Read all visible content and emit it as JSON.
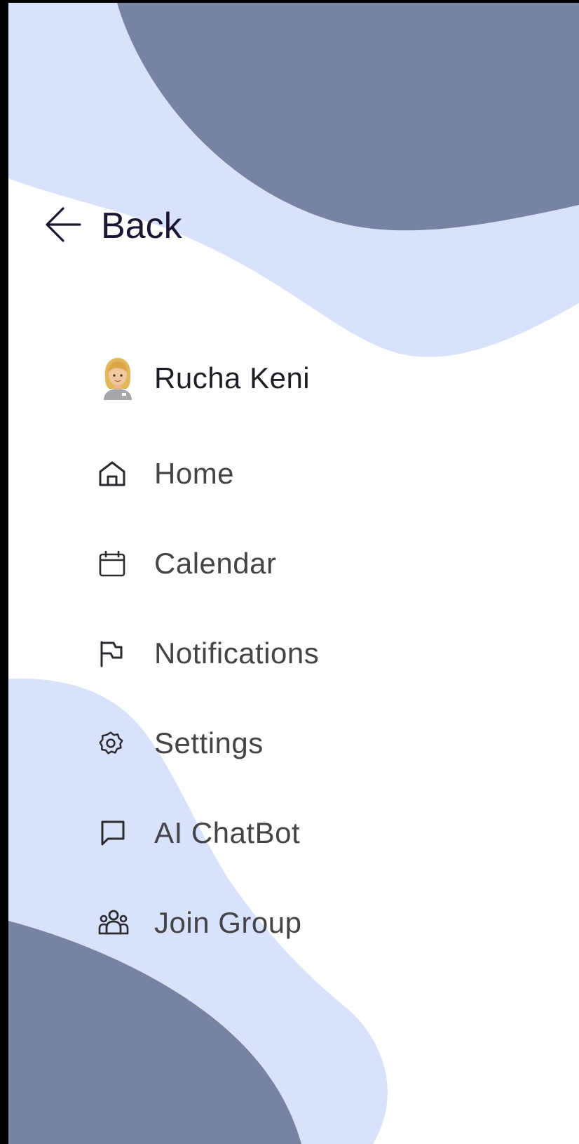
{
  "colors": {
    "dark_blob": "#7882a3",
    "light_blob": "#d8e2fb",
    "text_primary": "#1d1530",
    "text_menu": "#434348",
    "icon": "#2a2a30"
  },
  "back": {
    "icon": "arrow-left-icon",
    "label": "Back"
  },
  "profile": {
    "avatar": "woman-avatar-emoji",
    "name": "Rucha Keni"
  },
  "menu": {
    "items": [
      {
        "icon": "home-icon",
        "label": "Home"
      },
      {
        "icon": "calendar-icon",
        "label": "Calendar"
      },
      {
        "icon": "flag-icon",
        "label": "Notifications"
      },
      {
        "icon": "gear-icon",
        "label": "Settings"
      },
      {
        "icon": "chat-bubble-icon",
        "label": "AI ChatBot"
      },
      {
        "icon": "group-icon",
        "label": "Join Group"
      }
    ]
  }
}
